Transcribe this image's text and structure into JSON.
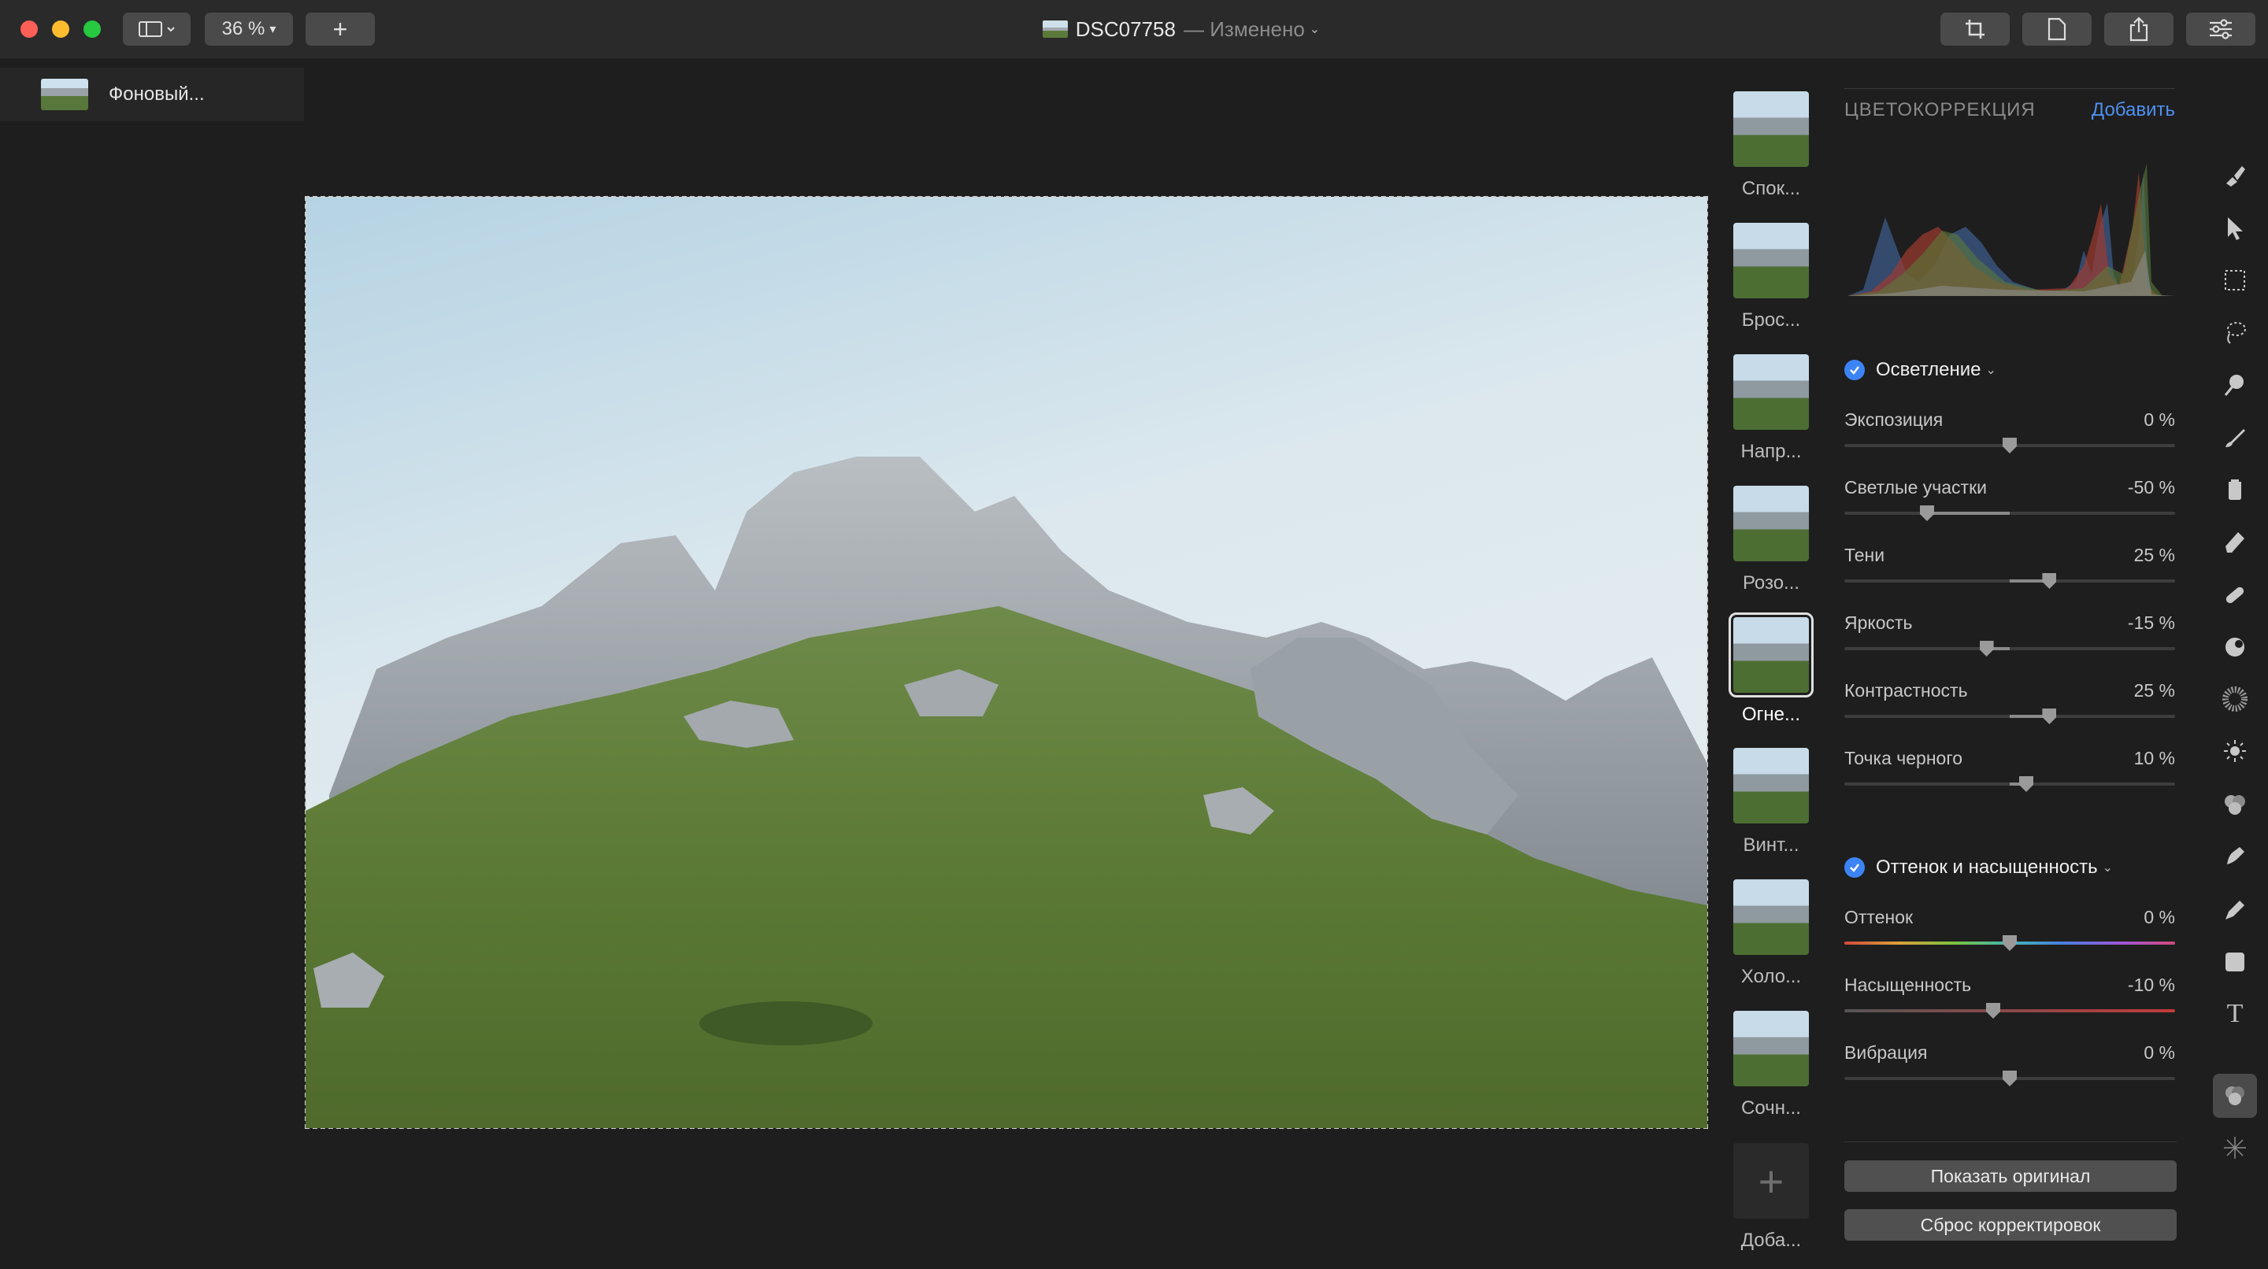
{
  "window": {
    "title": "DSC07758",
    "title_sub": "— Изменено",
    "zoom": "36 %"
  },
  "toolbar": {
    "sidebar_icon": "sidebar-icon",
    "add_label": "+",
    "right_icons": [
      "crop-icon",
      "document-icon",
      "share-icon",
      "adjustments-icon"
    ]
  },
  "layers": [
    {
      "label": "Фоновый..."
    }
  ],
  "presets": [
    {
      "label": "Спок..."
    },
    {
      "label": "Брос..."
    },
    {
      "label": "Напр..."
    },
    {
      "label": "Розо..."
    },
    {
      "label": "Огне...",
      "active": true
    },
    {
      "label": "Винт..."
    },
    {
      "label": "Холо..."
    },
    {
      "label": "Сочн..."
    },
    {
      "label": "Доба...",
      "add": true,
      "icon": "+"
    }
  ],
  "panel": {
    "header": "ЦВЕТОКОРРЕКЦИЯ",
    "add_label": "Добавить",
    "sections": [
      {
        "title": "Осветление",
        "sliders": [
          {
            "label": "Экспозиция",
            "value": "0 %",
            "pos": 0.5
          },
          {
            "label": "Светлые участки",
            "value": "-50 %",
            "pos": 0.25
          },
          {
            "label": "Тени",
            "value": "25 %",
            "pos": 0.62
          },
          {
            "label": "Яркость",
            "value": "-15 %",
            "pos": 0.43
          },
          {
            "label": "Контрастность",
            "value": "25 %",
            "pos": 0.62
          },
          {
            "label": "Точка черного",
            "value": "10 %",
            "pos": 0.55
          }
        ]
      },
      {
        "title": "Оттенок и насыщенность",
        "sliders": [
          {
            "label": "Оттенок",
            "value": "0 %",
            "pos": 0.5,
            "track": "hue"
          },
          {
            "label": "Насыщенность",
            "value": "-10 %",
            "pos": 0.45,
            "track": "sat"
          },
          {
            "label": "Вибрация",
            "value": "0 %",
            "pos": 0.5
          }
        ]
      }
    ],
    "show_original": "Показать оригинал",
    "reset": "Сброс корректировок"
  },
  "tools": [
    "style-brush-icon",
    "pointer-icon",
    "marquee-select-icon",
    "lasso-icon",
    "magic-wand-icon",
    "brush-icon",
    "fill-bucket-icon",
    "eraser-icon",
    "bandage-icon",
    "clone-icon",
    "blur-icon",
    "light-icon",
    "color-icon",
    "smudge-icon",
    "pen-icon",
    "shape-icon",
    "text-icon",
    "color-adjust-icon",
    "sparkle-icon"
  ]
}
